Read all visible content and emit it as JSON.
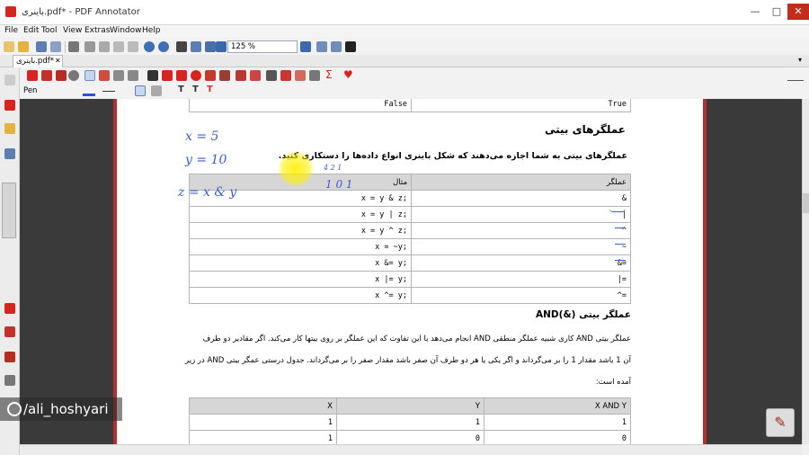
{
  "window": {
    "title": "باینری.pdf* - PDF Annotator",
    "min_glyph": "—",
    "max_glyph": "□",
    "close_glyph": "✕"
  },
  "menu": [
    "File",
    "Edit",
    "Tool",
    "View",
    "Extras",
    "Window",
    "Help"
  ],
  "toolbar": {
    "zoom_value": "125 %"
  },
  "tab": {
    "label": "باینری.pdf*",
    "close": "✕"
  },
  "pen_toolbar": {
    "tool_label": "Pen"
  },
  "page": {
    "top_table_row": [
      "False",
      "True"
    ],
    "section_title": "عملگرهای بیتی",
    "intro_text": "عملگرهای بیتی به شما اجازه می‌دهند که شکل باینری انواع داده‌ها را دستکاری کنید.",
    "op_table": {
      "headers": [
        "مثال",
        "عملگر"
      ],
      "rows": [
        [
          "x = y & z;",
          "&"
        ],
        [
          "x = y | z;",
          "|"
        ],
        [
          "x = y ^ z;",
          "^"
        ],
        [
          "x = ~y;",
          "~"
        ],
        [
          "x &= y;",
          "&="
        ],
        [
          "x |= y;",
          "|="
        ],
        [
          "x ^= y;",
          "^="
        ]
      ]
    },
    "and_title": "عملگر بیتی (&)AND",
    "and_para": [
      "عملگر بیتی AND کاری شبیه عملگر منطقی AND انجام می‌دهد با این تفاوت که این عملگر بر روی بیتها کار می‌کند. اگر مقادیر دو طرف",
      "آن 1 باشد مقدار 1 را بر می‌گرداند و اگر یکی یا هر دو طرف آن صفر باشد مقدار صفر را بر می‌گرداند. جدول درستی عمگر بیتی AND در زیر",
      "آمده است:"
    ],
    "and_table": {
      "headers": [
        "X",
        "Y",
        "X AND Y"
      ],
      "rows": [
        [
          "1",
          "1",
          "1"
        ],
        [
          "1",
          "0",
          "0"
        ]
      ]
    }
  },
  "handwriting": {
    "line1": "x = 5",
    "line2": "y = 10",
    "line3": "z = x & y",
    "bits_top": "4 2 1",
    "bits": "1 0 1"
  },
  "watermark": {
    "text": "/ali_hoshyari"
  },
  "colors": {
    "accent_red": "#d9231e",
    "page_border": "#b13131",
    "ink_blue": "#3a5fcd"
  }
}
